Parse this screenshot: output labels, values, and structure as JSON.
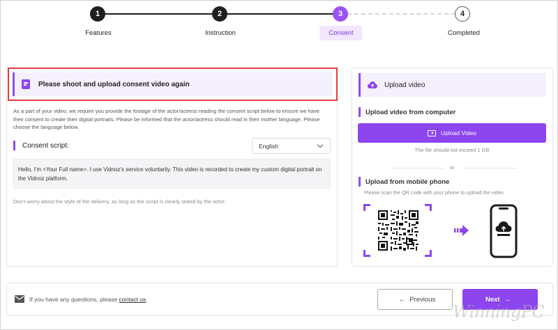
{
  "stepper": {
    "steps": [
      {
        "num": "1",
        "label": "Features",
        "state": "done"
      },
      {
        "num": "2",
        "label": "Instruction",
        "state": "done"
      },
      {
        "num": "3",
        "label": "Consent",
        "state": "active"
      },
      {
        "num": "4",
        "label": "Completed",
        "state": "todo"
      }
    ]
  },
  "consent": {
    "alert": "Please shoot and upload consent video again",
    "intro": "As a part of your video, we require you provide the footage of the actor/actress reading the consent script below to ensure we have their consent to create their digital portraits. Please be informed that the actor/actress should read in their mother language. Please choose the language below.",
    "script_label": "Consent script:",
    "language": "English",
    "script_text": "Hello, I'm <Your Full name>. I use Vidnoz's service voluntarily. This video is recorded to create my custom digital portrait on the Vidnoz platform.",
    "note": "Don't worry about the style of the delivery, as long as the script is clearly stated by the actor."
  },
  "upload": {
    "header": "Upload video",
    "computer_title": "Upload video from computer",
    "button": "Upload Video",
    "size_hint": "The file should not exceed 1 GB",
    "or": "or",
    "mobile_title": "Upload from mobile phone",
    "mobile_hint": "Please scan the QR code with your phone to upload the video"
  },
  "footer": {
    "help_prefix": "If you have any questions, please ",
    "help_link": "contact us",
    "help_suffix": ".",
    "previous": "Previous",
    "next": "Next"
  },
  "watermark": "WinningPC",
  "colors": {
    "accent": "#8d45ee",
    "alert_border": "#e3393d",
    "step_done": "#1f1f1f"
  },
  "icons": [
    "document-icon",
    "cloud-upload-icon",
    "upload-icon",
    "qr-code-icon",
    "arrow-right-icon",
    "phone-icon",
    "mail-icon"
  ]
}
